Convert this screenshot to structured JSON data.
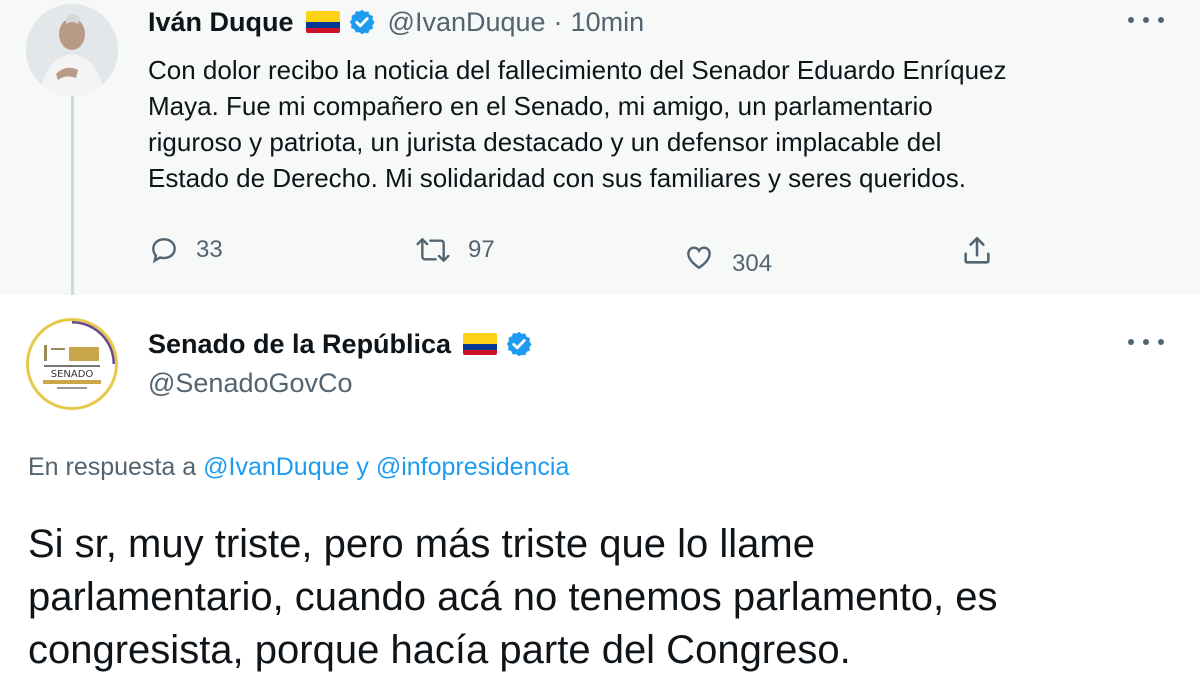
{
  "parent_tweet": {
    "author_name": "Iván Duque",
    "handle": "@IvanDuque",
    "separator": "·",
    "time": "10min",
    "text_lines": [
      "Con dolor recibo la noticia del fallecimiento del Senador Eduardo Enríquez",
      "Maya. Fue mi compañero en el Senado, mi amigo, un parlamentario",
      "riguroso y patriota, un jurista destacado y un defensor implacable del",
      "Estado de Derecho. Mi solidaridad con sus familiares y seres queridos."
    ],
    "actions": {
      "replies": "33",
      "retweets": "97",
      "likes": "304"
    },
    "icons": [
      "verified-badge-icon",
      "colombia-flag-icon",
      "reply-icon",
      "retweet-icon",
      "like-icon",
      "share-icon",
      "more-icon"
    ]
  },
  "reply_tweet": {
    "author_name": "Senado de la República",
    "handle": "@SenadoGovCo",
    "in_reply_prefix": "En respuesta a",
    "mention_1": "@IvanDuque",
    "conjunction": "y",
    "mention_2": "@infopresidencia",
    "text_lines": [
      "Si sr, muy triste, pero más triste que lo llame",
      "parlamentario, cuando acá no tenemos parlamento, es",
      "congresista, porque hacía parte del Congreso."
    ],
    "avatar_logo_text": "SENADO"
  },
  "colors": {
    "accent": "#1d9bf0",
    "secondary_text": "#536471",
    "parent_background": "#f7f9f9"
  }
}
